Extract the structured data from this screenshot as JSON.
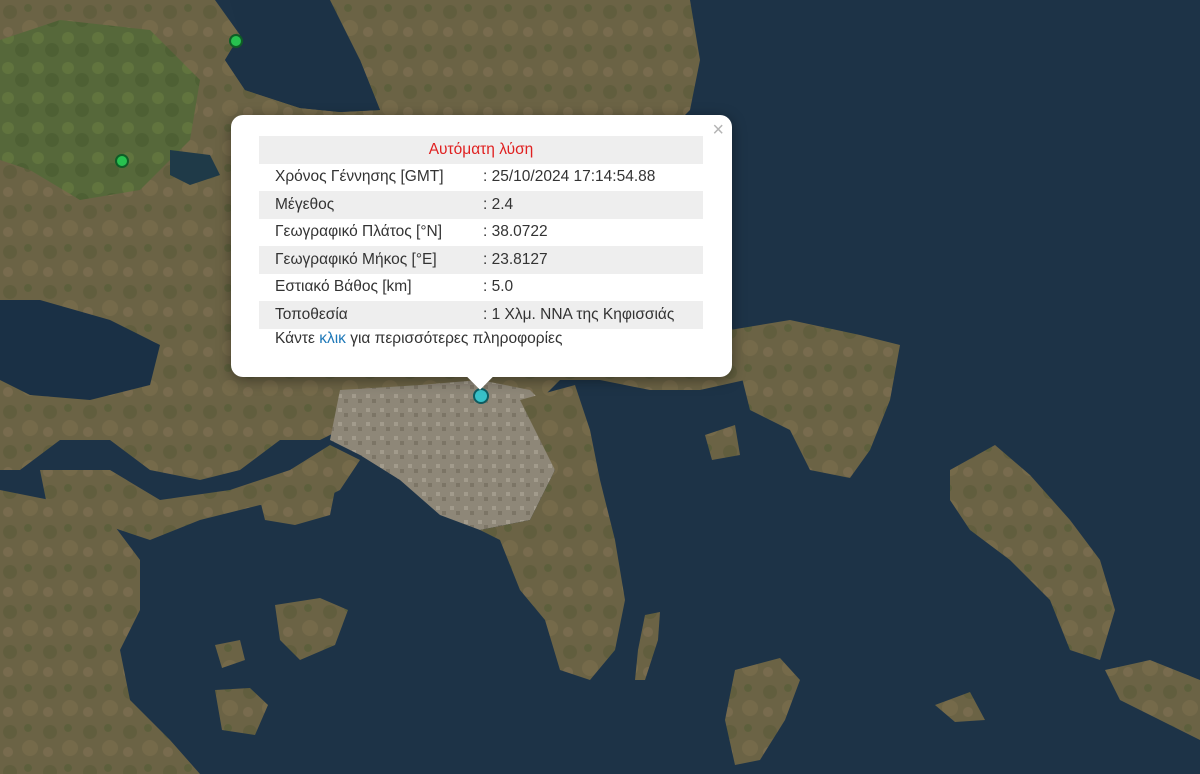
{
  "popup": {
    "title": "Αυτόματη λύση",
    "close_glyph": "×",
    "rows": [
      {
        "label": "Χρόνος Γέννησης [GMT]",
        "value": ": 25/10/2024 17:14:54.88"
      },
      {
        "label": "Μέγεθος",
        "value": ": 2.4"
      },
      {
        "label": "Γεωγραφικό Πλάτος [°N]",
        "value": ": 38.0722"
      },
      {
        "label": "Γεωγραφικό Μήκος [°E]",
        "value": ": 23.8127"
      },
      {
        "label": "Εστιακό Βάθος [km]",
        "value": ": 5.0"
      },
      {
        "label": "Τοποθεσία",
        "value": ": 1 Χλμ. ΝΝΑ της Κηφισσιάς"
      }
    ],
    "more": {
      "before": "Κάντε ",
      "link": "κλικ",
      "after": " για περισσότερες πληροφορίες"
    }
  },
  "colors": {
    "sea": "#1d3347",
    "land": "#6b6345",
    "urban": "#8e8778",
    "title_red": "#e02020",
    "link_blue": "#1e78b8",
    "marker_green": "#27c14f",
    "marker_cyan": "#38c1c8"
  },
  "markers": [
    {
      "name": "earthquake-marker-green",
      "color": "green"
    },
    {
      "name": "earthquake-marker-green",
      "color": "green"
    },
    {
      "name": "earthquake-marker-selected",
      "color": "cyan"
    }
  ]
}
